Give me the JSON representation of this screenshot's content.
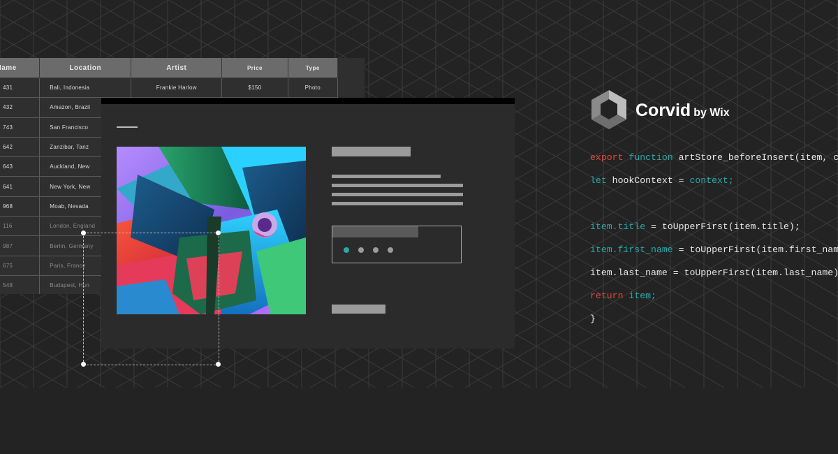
{
  "colors": {
    "background": "#232323",
    "teal": "#2aa9a9",
    "red": "#e24a3a",
    "code_text": "#e8e8e8"
  },
  "table": {
    "headers": [
      "Name",
      "Location",
      "Artist",
      "Price",
      "Type"
    ],
    "rows": [
      [
        "431",
        "Bali, Indonesia",
        "Frankie Harlow",
        "$150",
        "Photo"
      ],
      [
        "432",
        "Amazon, Brazil",
        "",
        "",
        ""
      ],
      [
        "743",
        "San Francisco",
        "",
        "",
        ""
      ],
      [
        "642",
        "Zanzibar, Tanz",
        "",
        "",
        ""
      ],
      [
        "643",
        "Auckland, New",
        "",
        "",
        ""
      ],
      [
        "641",
        "New York, New",
        "",
        "",
        ""
      ],
      [
        "968",
        "Moab, Nevada",
        "",
        "",
        ""
      ],
      [
        "116",
        "London, England",
        "",
        "",
        ""
      ],
      [
        "987",
        "Berlin, Germany",
        "",
        "",
        ""
      ],
      [
        "675",
        "Paris, France",
        "",
        "",
        ""
      ],
      [
        "548",
        "Budapest, Hun",
        "",
        "",
        ""
      ]
    ]
  },
  "preview": {
    "carousel_dots": 4,
    "active_dot": 0,
    "photo_icon": "tropical-leaves-photo"
  },
  "brand": {
    "logo_icon": "corvid-hexagon-icon",
    "name": "Corvid",
    "by": "by Wix"
  },
  "code": [
    [
      {
        "t": "export function ",
        "c": "kw"
      },
      {
        "t": "artStore_beforeInsert(item, co",
        "c": "pl"
      }
    ],
    [
      {
        "t": "let ",
        "c": "kw2"
      },
      {
        "t": "hookContext = ",
        "c": "pl"
      },
      {
        "t": "context;",
        "c": "kw2"
      }
    ],
    [],
    [
      {
        "t": "item.title",
        "c": "kw2"
      },
      {
        "t": " = toUpperFirst(item.title);",
        "c": "pl"
      }
    ],
    [
      {
        "t": "item.first_name",
        "c": "kw2"
      },
      {
        "t": " = toUpperFirst(item.first_name",
        "c": "pl"
      }
    ],
    [
      {
        "t": "item.last_name = toUpperFirst(item.last_name);",
        "c": "pl"
      }
    ],
    [
      {
        "t": "return ",
        "c": "red"
      },
      {
        "t": "item;",
        "c": "kw2"
      }
    ],
    [
      {
        "t": "}",
        "c": "pl"
      }
    ]
  ]
}
